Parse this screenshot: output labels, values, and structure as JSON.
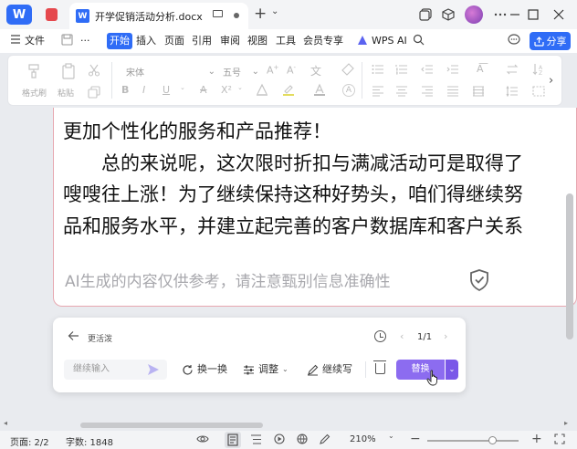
{
  "titlebar": {
    "app_logo": "W",
    "doc_icon": "W",
    "doc_title": "开学促销活动分析.docx",
    "new_tab": "+",
    "new_tab_menu": "⌄"
  },
  "menubar": {
    "file": "文件",
    "more": "···",
    "tabs": [
      "开始",
      "插入",
      "页面",
      "引用",
      "审阅",
      "视图",
      "工具",
      "会员专享"
    ],
    "wps_ai": "WPS AI",
    "share": "分享"
  },
  "ribbon": {
    "format_painter": "格式刷",
    "paste": "粘贴",
    "font_name": "宋体",
    "font_size": "五号",
    "bold": "B",
    "italic": "I",
    "underline": "U",
    "strike": "A",
    "superscript": "X²",
    "clear": "A"
  },
  "document": {
    "lines": [
      "更加个性化的服务和产品推荐！",
      "　　总的来说呢，这次限时折扣与满减活动可是取得了",
      "嗖嗖往上涨！为了继续保持这种好势头，咱们得继续努",
      "品和服务水平，并建立起完善的客户数据库和客户关系"
    ],
    "ai_disclaimer": "AI生成的内容仅供参考，请注意甄别信息准确性"
  },
  "ai_panel": {
    "back_label": "更活泼",
    "pagination": "1/1",
    "input_placeholder": "继续输入",
    "actions": {
      "swap": "换一换",
      "adjust": "调整",
      "continue_write": "继续写"
    },
    "replace": "替换"
  },
  "statusbar": {
    "page": "页面: 2/2",
    "word_count": "字数: 1848",
    "zoom": "210%",
    "zoom_level": 0.71
  },
  "colors": {
    "accent": "#2f6cf6",
    "ai_purple": "#8c6cf0"
  }
}
